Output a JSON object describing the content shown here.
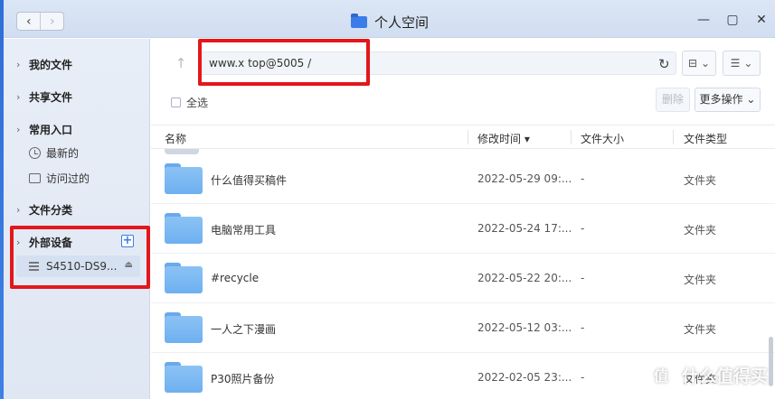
{
  "window": {
    "title": "个人空间",
    "nav_back_glyph": "‹",
    "nav_forward_glyph": "›",
    "minimize_glyph": "—",
    "maximize_glyph": "▢",
    "close_glyph": "✕"
  },
  "sidebar": {
    "groups": [
      {
        "label": "我的文件"
      },
      {
        "label": "共享文件"
      },
      {
        "label": "常用入口",
        "items": [
          {
            "label": "最新的",
            "icon": "clock-icon"
          },
          {
            "label": "访问过的",
            "icon": "recent-folder-icon"
          }
        ]
      },
      {
        "label": "文件分类"
      },
      {
        "label": "外部设备",
        "add_glyph": "+",
        "device": {
          "label": "S4510-DS9...",
          "icon": "disk-icon",
          "eject_glyph": "⏏"
        }
      }
    ]
  },
  "toolbar": {
    "up_glyph": "↑",
    "address": "www.x          top@5005 /",
    "refresh_glyph": "↻",
    "select_all": "全选",
    "delete": "删除",
    "more_actions": "更多操作",
    "more_caret": "⌄"
  },
  "table": {
    "columns": [
      "名称",
      "修改时间 ▾",
      "文件大小",
      "文件类型"
    ],
    "rows": [
      {
        "name": "什么值得买稿件",
        "modified": "2022-05-29 09:...",
        "size": "-",
        "type": "文件夹"
      },
      {
        "name": "电脑常用工具",
        "modified": "2022-05-24 17:...",
        "size": "-",
        "type": "文件夹"
      },
      {
        "name": "#recycle",
        "modified": "2022-05-22 20:...",
        "size": "-",
        "type": "文件夹"
      },
      {
        "name": "一人之下漫画",
        "modified": "2022-05-12 03:...",
        "size": "-",
        "type": "文件夹"
      },
      {
        "name": "P30照片备份",
        "modified": "2022-02-05 23:...",
        "size": "-",
        "type": "文件夹"
      }
    ]
  },
  "watermark": {
    "logo_glyph": "值",
    "text": "什么值得买"
  },
  "colors": {
    "accent": "#3a7cea",
    "highlight_box": "#e3171b",
    "folder": "#7ab8f2"
  }
}
